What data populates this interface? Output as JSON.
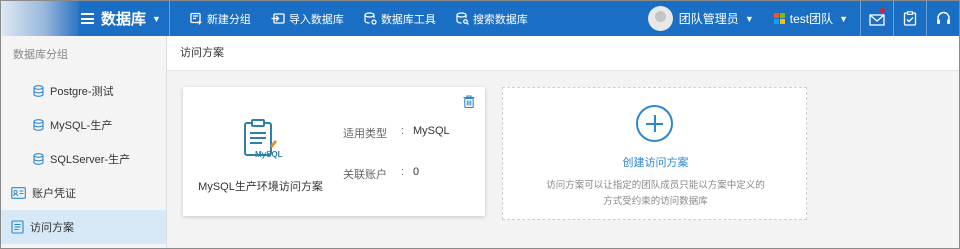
{
  "header": {
    "app_title": "数据库",
    "tools": [
      {
        "label": "新建分组",
        "icon": "new-group-icon"
      },
      {
        "label": "导入数据库",
        "icon": "import-icon"
      },
      {
        "label": "数据库工具",
        "icon": "db-tools-icon"
      },
      {
        "label": "搜索数据库",
        "icon": "db-search-icon"
      }
    ],
    "user_name": "团队管理员",
    "team_name": "test团队",
    "icons": [
      "mail-icon",
      "clipboard-check-icon",
      "headset-icon"
    ]
  },
  "sidebar": {
    "heading": "数据库分组",
    "groups": [
      "Postgre-测试",
      "MySQL-生产",
      "SQLServer-生产"
    ],
    "nav": [
      {
        "label": "账户凭证",
        "icon": "id-card-icon"
      },
      {
        "label": "访问方案",
        "icon": "document-icon",
        "active": true
      }
    ]
  },
  "breadcrumb": "访问方案",
  "plan_card": {
    "name": "MySQL生产环境访问方案",
    "icon_text": "MySQL",
    "fields": [
      {
        "label": "适用类型",
        "sep": ":",
        "value": "MySQL"
      },
      {
        "label": "关联账户",
        "sep": ":",
        "value": "0"
      }
    ]
  },
  "create_card": {
    "title": "创建访问方案",
    "desc_line1": "访问方案可以让指定的团队成员只能以方案中定义的",
    "desc_line2": "方式受约束的访问数据库"
  },
  "colors": {
    "topbar": "#1a6fc4",
    "accent": "#2b86d3",
    "active_nav": "#d7e8f7"
  }
}
